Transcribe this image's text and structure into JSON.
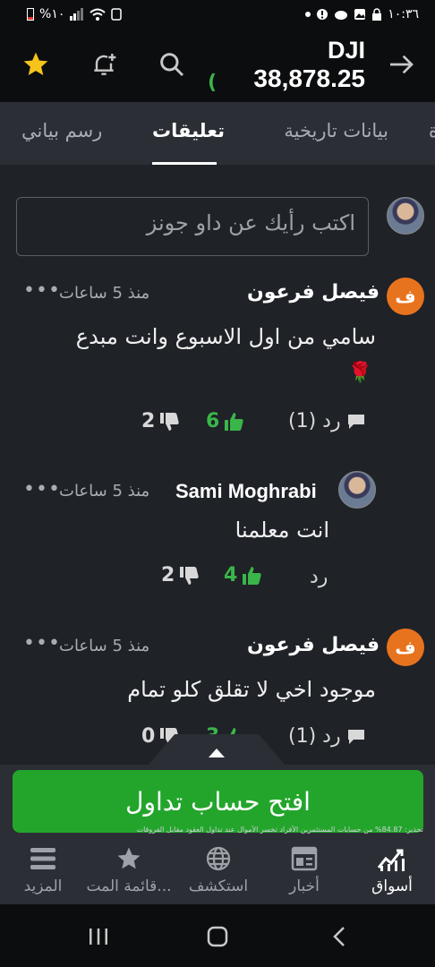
{
  "status_bar": {
    "battery": "%١٠",
    "time": "١٠:٣٦",
    "icons": [
      "battery-icon",
      "signal-icon",
      "wifi-icon",
      "sim-icon",
      "dot-icon",
      "alert-icon",
      "cloud-icon",
      "image-icon",
      "lock-icon"
    ]
  },
  "header": {
    "ticker": "DJI",
    "price": "38,878.25",
    "price_change_partial": "(",
    "icons": [
      "star-icon",
      "add-alert-icon",
      "search-icon",
      "forward-arrow-icon"
    ],
    "colors": {
      "star": "#f6c31a",
      "positive": "#3ab54a"
    }
  },
  "tabs": [
    {
      "label": "بيانات تاريخية",
      "active": false
    },
    {
      "label": "تعليقات",
      "active": true
    },
    {
      "label": "رسم بياني",
      "active": false
    }
  ],
  "comment_input": {
    "placeholder": "اكتب رأيك عن داو جونز"
  },
  "comments": [
    {
      "avatar_letter": "ف",
      "author": "فيصل فرعون",
      "time": "منذ 5 ساعات",
      "text": "سامي من اول الاسبوع وانت مبدع",
      "emoji": "🌹",
      "reply_label": "رد (1)",
      "likes": "6",
      "dislikes": "2"
    },
    {
      "avatar_letter": "",
      "author": "Sami Moghrabi",
      "time": "منذ 5 ساعات",
      "text": "انت معلمنا",
      "reply_label": "رد",
      "likes": "4",
      "dislikes": "2"
    },
    {
      "avatar_letter": "ف",
      "author": "فيصل فرعون",
      "time": "منذ 5 ساعات",
      "text": "موجود اخي لا تقلق كلو تمام",
      "reply_label": "رد (1)",
      "likes": "3",
      "dislikes": "0"
    }
  ],
  "promo": {
    "cta_label": "افتح حساب تداول",
    "disclaimer": "تحذير: 84.87% من حسابات المستثمرين الأفراد تخسر الأموال عند تداول العقود مقابل الفروقات"
  },
  "bottom_nav": [
    {
      "label": "أسواق",
      "icon": "markets-chart-icon",
      "active": true
    },
    {
      "label": "أخبار",
      "icon": "news-icon",
      "active": false
    },
    {
      "label": "استكشف",
      "icon": "globe-icon",
      "active": false
    },
    {
      "label": "قائمة المت...",
      "icon": "star-icon",
      "active": false
    },
    {
      "label": "المزيد",
      "icon": "menu-icon",
      "active": false
    }
  ],
  "system_nav": {
    "icons": [
      "recents-icon",
      "home-icon",
      "back-icon"
    ]
  }
}
